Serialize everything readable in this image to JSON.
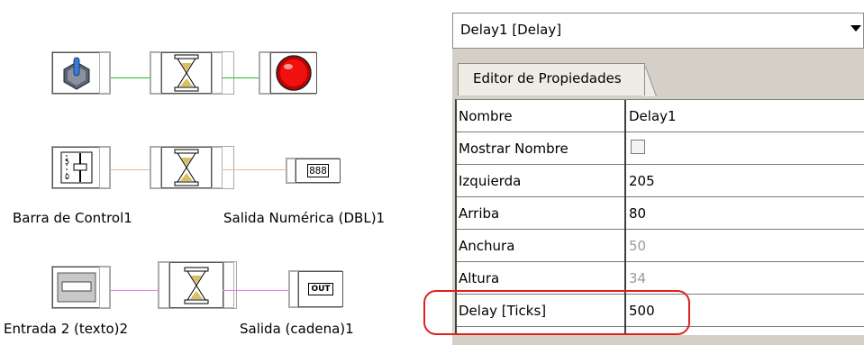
{
  "diagram": {
    "row1": {
      "wire_color": "#18c418"
    },
    "row2": {
      "wire_color": "#f0b890",
      "left_caption": "Barra de Control1",
      "right_caption": "Salida Numérica (DBL)1",
      "numeric_display": "888"
    },
    "row3": {
      "wire_color": "#f07cf0",
      "left_caption": "Entrada 2 (texto)2",
      "right_caption": "Salida (cadena)1",
      "output_tag": "OUT"
    }
  },
  "inspector": {
    "selector_value": "Delay1 [Delay]",
    "tab_label": "Editor de Propiedades",
    "properties": [
      {
        "name": "Nombre",
        "value": "Delay1"
      },
      {
        "name": "Mostrar Nombre",
        "value": ""
      },
      {
        "name": "Izquierda",
        "value": "205"
      },
      {
        "name": "Arriba",
        "value": "80"
      },
      {
        "name": "Anchura",
        "value": "50"
      },
      {
        "name": "Altura",
        "value": "34"
      },
      {
        "name": "Delay [Ticks]",
        "value": "500"
      }
    ],
    "highlight_color": "#e02020"
  }
}
